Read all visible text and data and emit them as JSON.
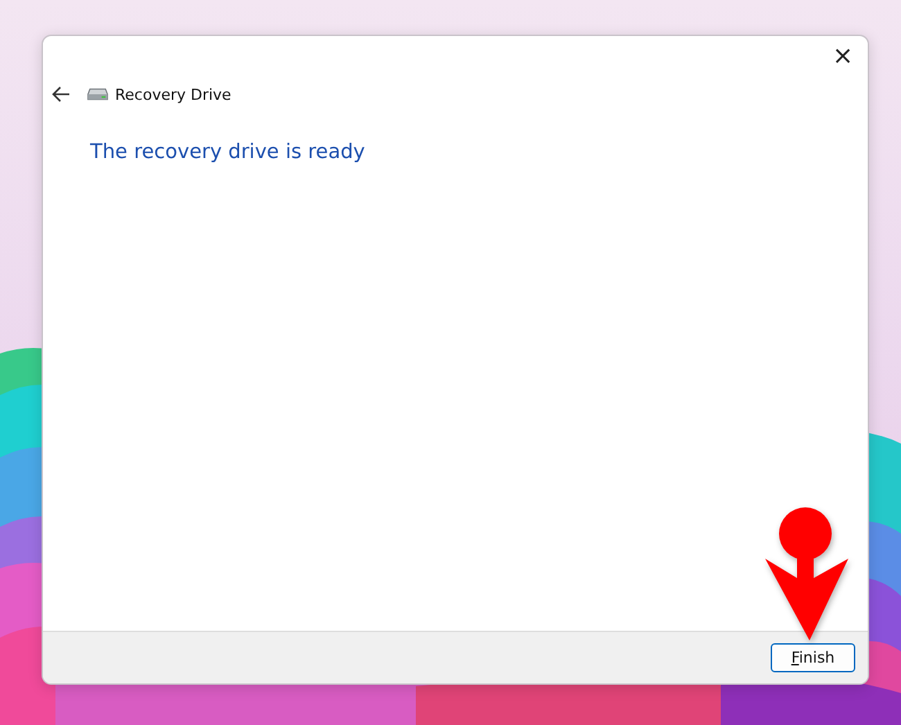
{
  "window": {
    "title": "Recovery Drive",
    "close": "×"
  },
  "heading": "The recovery drive is ready",
  "buttons": [
    {
      "label": "Finish",
      "default": true
    }
  ],
  "annotations": [
    {
      "kind": "pointer-arrow",
      "color": "#ff0000"
    }
  ]
}
